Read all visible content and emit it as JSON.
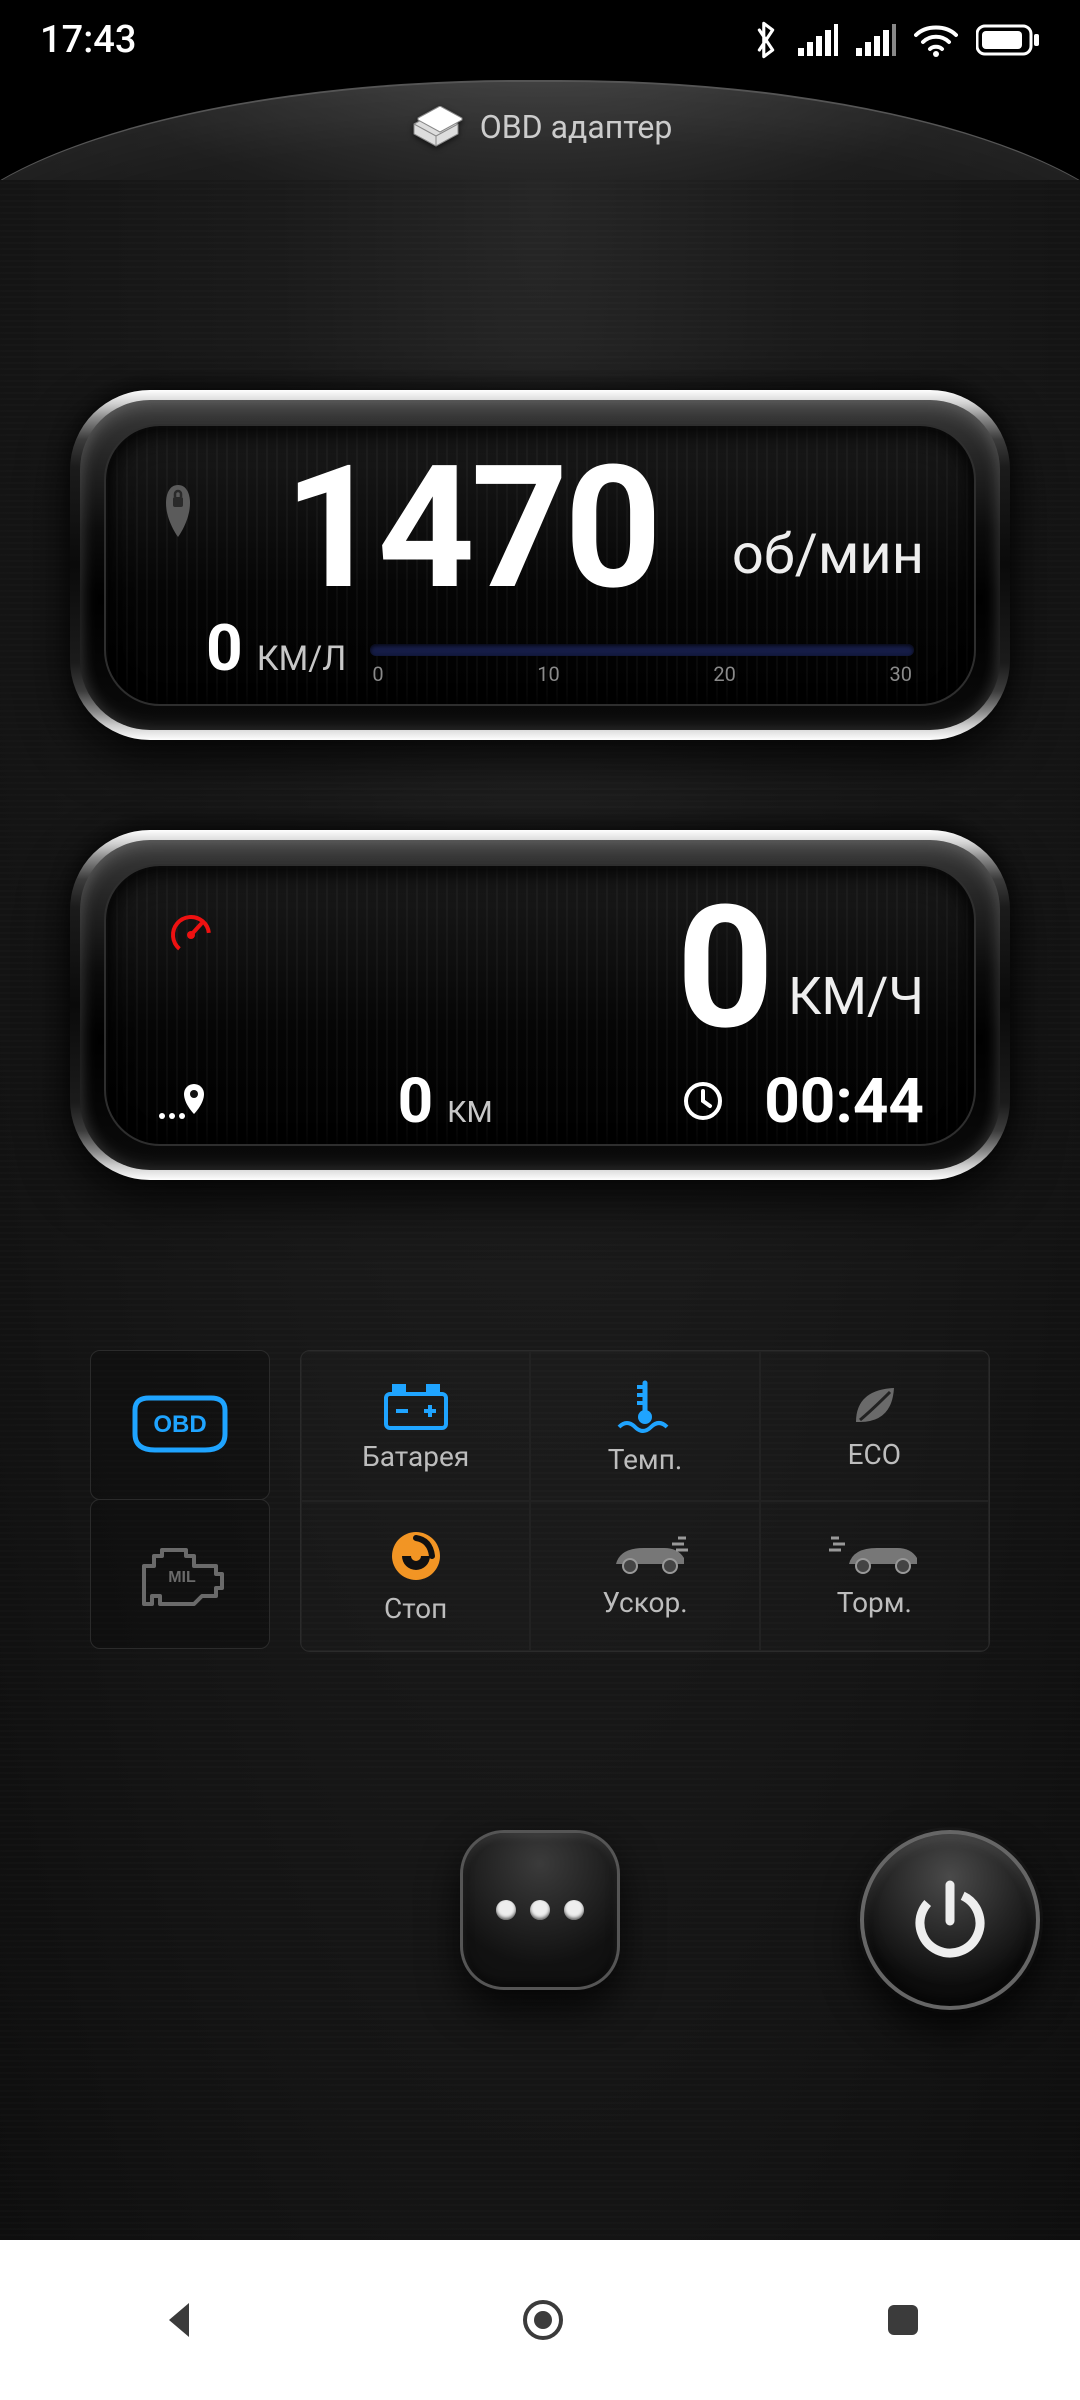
{
  "status": {
    "time": "17:43"
  },
  "header": {
    "title": "OBD адаптер"
  },
  "gauge_rpm": {
    "value": "1470",
    "unit": "об/мин",
    "fuel_value": "0",
    "fuel_unit": "КМ/Л",
    "ticks": {
      "t0": "0",
      "t1": "10",
      "t2": "20",
      "t3": "30"
    }
  },
  "gauge_speed": {
    "value": "0",
    "unit": "КМ/Ч",
    "distance_value": "0",
    "distance_unit": "КМ",
    "time": "00:44"
  },
  "tiles": {
    "obd": "OBD",
    "battery": "Батарея",
    "temp": "Темп.",
    "eco": "ECO",
    "stop": "Стоп",
    "accel": "Ускор.",
    "brake": "Торм."
  }
}
